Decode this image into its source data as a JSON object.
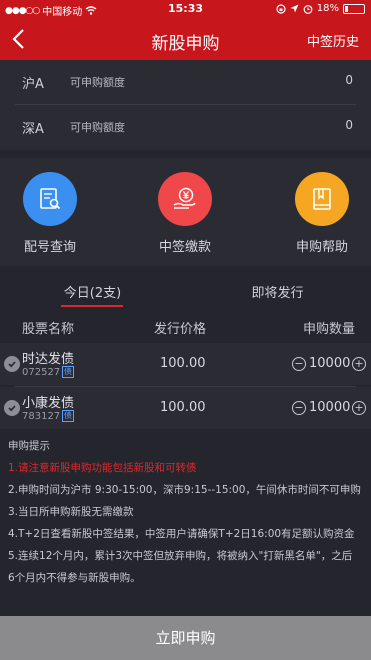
{
  "status_bar": {
    "carrier": "中国移动",
    "time": "15:33",
    "battery": "18%",
    "battery_level": 0.18
  },
  "nav": {
    "title": "新股申购",
    "history_label": "中签历史"
  },
  "quota": [
    {
      "market": "沪A",
      "label": "可申购额度",
      "value": "0"
    },
    {
      "market": "深A",
      "label": "可申购额度",
      "value": "0"
    }
  ],
  "actions": [
    {
      "label": "配号查询",
      "icon": "document-search-icon",
      "color": "#3a8ff0"
    },
    {
      "label": "中签缴款",
      "icon": "yen-hand-icon",
      "color": "#f0484a"
    },
    {
      "label": "申购帮助",
      "icon": "book-icon",
      "color": "#f5a623"
    }
  ],
  "tabs": [
    "今日(2支)",
    "即将发行"
  ],
  "table": {
    "headers": [
      "股票名称",
      "发行价格",
      "申购数量"
    ],
    "rows": [
      {
        "name": "时达发债",
        "code": "072527",
        "badge": "债",
        "price": "100.00",
        "qty": "10000"
      },
      {
        "name": "小康发债",
        "code": "783127",
        "badge": "债",
        "price": "100.00",
        "qty": "10000"
      }
    ]
  },
  "tips": {
    "title": "申购提示",
    "lines": [
      "1.请注意新股申购功能包括新股和可转债",
      "2.申购时间为沪市 9:30-15:00，深市9:15--15:00，午间休市时间不可申购",
      "3.当日所申购新股无需缴款",
      "4.T+2日查看新股中签结果，中签用户请确保T+2日16:00有足额认购资金",
      "5.连续12个月内，累计3次中签但放弃申购，将被纳入\"打新黑名单\"，之后",
      "6个月内不得参与新股申购。"
    ]
  },
  "submit_label": "立即申购"
}
